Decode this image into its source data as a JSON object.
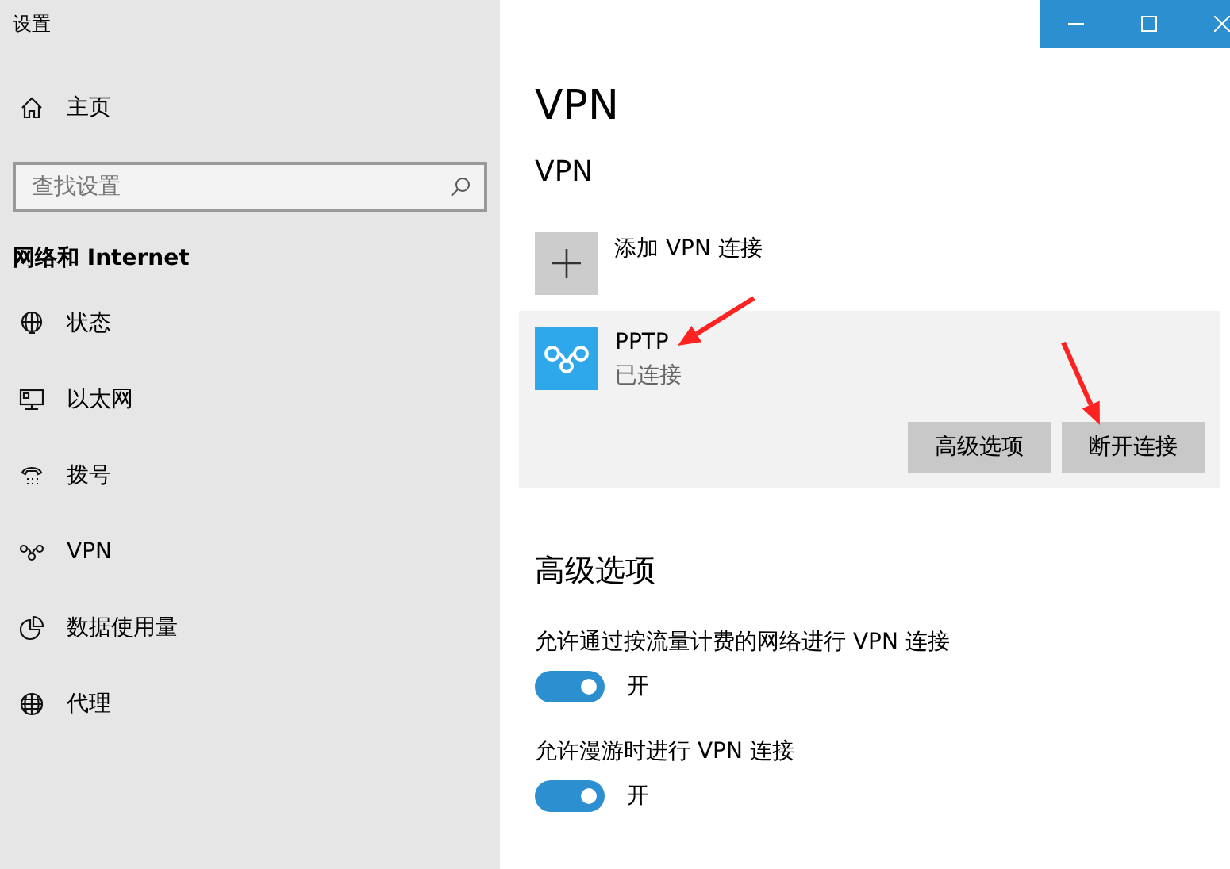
{
  "window": {
    "title": "设置",
    "controls": [
      {
        "kind": "minimize"
      },
      {
        "kind": "maximize"
      },
      {
        "kind": "close"
      }
    ]
  },
  "sidebar": {
    "home": {
      "label": "主页"
    },
    "search": {
      "placeholder": "查找设置"
    },
    "section": "网络和 Internet",
    "items": [
      {
        "kind": "status",
        "label": "状态"
      },
      {
        "kind": "ethernet",
        "label": "以太网"
      },
      {
        "kind": "dialup",
        "label": "拨号"
      },
      {
        "kind": "vpn",
        "label": "VPN"
      },
      {
        "kind": "data",
        "label": "数据使用量"
      },
      {
        "kind": "proxy",
        "label": "代理"
      }
    ]
  },
  "page": {
    "title": "VPN",
    "subtitle": "VPN",
    "add": {
      "label": "添加 VPN 连接"
    },
    "connection": {
      "name": "PPTP",
      "status": "已连接",
      "name_arrow": true,
      "buttons": [
        {
          "label": "高级选项",
          "arrow": false
        },
        {
          "label": "断开连接",
          "arrow": true
        }
      ]
    },
    "advanced": {
      "title": "高级选项",
      "options": [
        {
          "label": "允许通过按流量计费的网络进行 VPN 连接",
          "on": true,
          "state": "开"
        },
        {
          "label": "允许漫游时进行 VPN 连接",
          "on": true,
          "state": "开"
        }
      ]
    }
  }
}
